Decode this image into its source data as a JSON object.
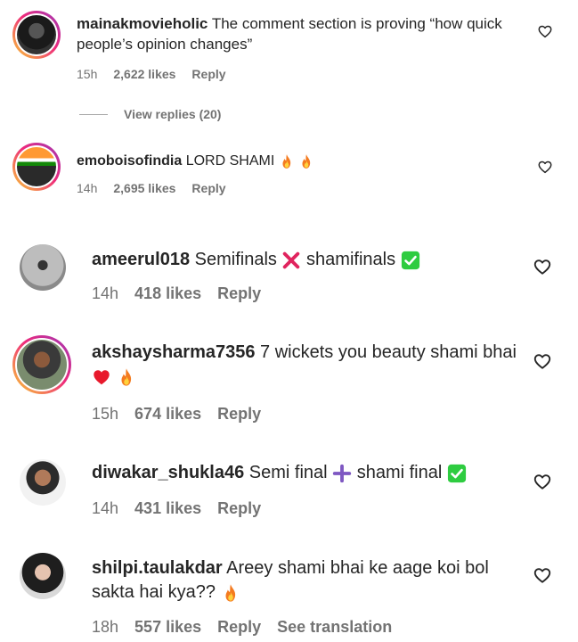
{
  "comments": [
    {
      "username": "mainakmovieholic",
      "text": "The comment section is proving “how quick people’s opinion changes”",
      "time": "15h",
      "likes": "2,622 likes",
      "reply": "Reply"
    },
    {
      "username": "emoboisofindia",
      "text": "LORD SHAMI",
      "time": "14h",
      "likes": "2,695 likes",
      "reply": "Reply"
    },
    {
      "username": "ameerul018",
      "text_a": "Semifinals",
      "text_b": "shamifinals",
      "time": "14h",
      "likes": "418 likes",
      "reply": "Reply"
    },
    {
      "username": "akshaysharma7356",
      "text": "7 wickets you beauty shami bhai",
      "time": "15h",
      "likes": "674 likes",
      "reply": "Reply"
    },
    {
      "username": "diwakar_shukla46",
      "text_a": "Semi final",
      "text_b": "shami final",
      "time": "14h",
      "likes": "431 likes",
      "reply": "Reply"
    },
    {
      "username": "shilpi.taulakdar",
      "text": "Areey shami bhai ke aage koi bol sakta hai kya??",
      "time": "18h",
      "likes": "557 likes",
      "reply": "Reply",
      "translate": "See translation"
    }
  ],
  "view_replies": "View replies (20)",
  "icons": {
    "like": "heart-outline-icon",
    "fire": "fire-emoji-icon",
    "cross": "cross-mark-emoji-icon",
    "check": "check-mark-emoji-icon",
    "plus": "plus-emoji-icon",
    "heart": "red-heart-emoji-icon"
  },
  "colors": {
    "username": "#262626",
    "meta": "#737373",
    "story_ring": "#ee2a7b",
    "check_green": "#2ecc40",
    "cross_red": "#e0245e",
    "plus_purple": "#7e57c2"
  }
}
